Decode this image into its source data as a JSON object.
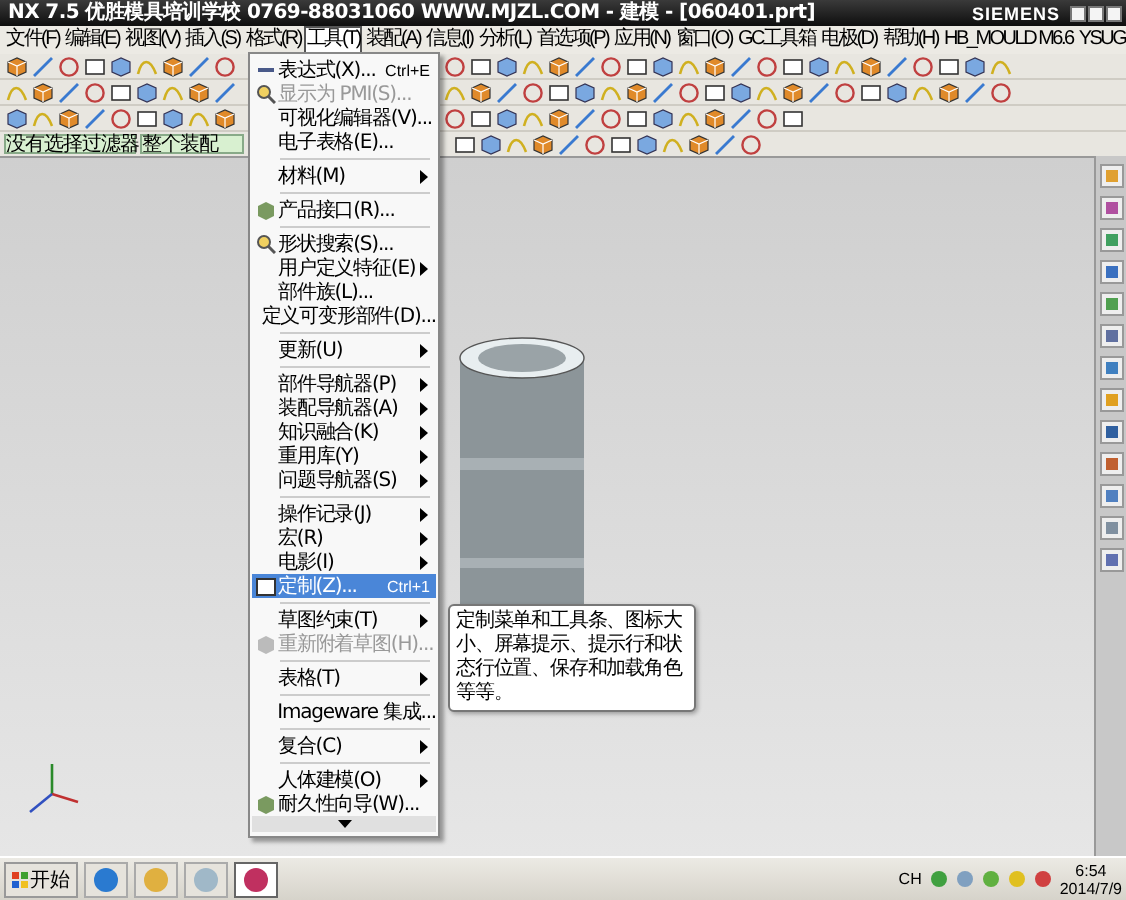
{
  "title_bar": {
    "title": "NX 7.5  优胜模具培训学校  0769-88031060  WWW.MJZL.COM - 建模 - [060401.prt]",
    "brand": "SIEMENS"
  },
  "menu_bar": {
    "items": [
      {
        "label": "文件(F)",
        "selected": false
      },
      {
        "label": "编辑(E)",
        "selected": false
      },
      {
        "label": "视图(V)",
        "selected": false
      },
      {
        "label": "插入(S)",
        "selected": false
      },
      {
        "label": "格式(R)",
        "selected": false
      },
      {
        "label": "工具(T)",
        "selected": true
      },
      {
        "label": "装配(A)",
        "selected": false
      },
      {
        "label": "信息(I)",
        "selected": false
      },
      {
        "label": "分析(L)",
        "selected": false
      },
      {
        "label": "首选项(P)",
        "selected": false
      },
      {
        "label": "应用(N)",
        "selected": false
      },
      {
        "label": "窗口(O)",
        "selected": false
      },
      {
        "label": "GC工具箱",
        "selected": false
      },
      {
        "label": "电极(D)",
        "selected": false
      },
      {
        "label": "帮助(H)",
        "selected": false
      },
      {
        "label": "HB_MOULD M6.6",
        "selected": false
      },
      {
        "label": "YSUG",
        "selected": false
      }
    ]
  },
  "selection_bar": {
    "filter": "没有选择过滤器",
    "scope": "整个装配"
  },
  "tools_menu": {
    "groups": [
      [
        {
          "label": "表达式(X)...",
          "shortcut": "Ctrl+E",
          "submenu": false,
          "disabled": false,
          "selected": false,
          "icon": true
        },
        {
          "label": "显示为 PMI(S)...",
          "submenu": false,
          "disabled": true,
          "selected": false,
          "icon": true
        },
        {
          "label": "可视化编辑器(V)...",
          "submenu": false,
          "disabled": false,
          "selected": false,
          "icon": false
        },
        {
          "label": "电子表格(E)...",
          "submenu": false,
          "disabled": false,
          "selected": false,
          "icon": false
        }
      ],
      [
        {
          "label": "材料(M)",
          "submenu": true,
          "disabled": false,
          "selected": false,
          "icon": false
        }
      ],
      [
        {
          "label": "产品接口(R)...",
          "submenu": false,
          "disabled": false,
          "selected": false,
          "icon": true
        }
      ],
      [
        {
          "label": "形状搜索(S)...",
          "submenu": false,
          "disabled": false,
          "selected": false,
          "icon": true
        },
        {
          "label": "用户定义特征(E)",
          "submenu": true,
          "disabled": false,
          "selected": false,
          "icon": false
        },
        {
          "label": "部件族(L)...",
          "submenu": false,
          "disabled": false,
          "selected": false,
          "icon": false
        },
        {
          "label": "定义可变形部件(D)...",
          "submenu": false,
          "disabled": false,
          "selected": false,
          "icon": false
        }
      ],
      [
        {
          "label": "更新(U)",
          "submenu": true,
          "disabled": false,
          "selected": false,
          "icon": false
        }
      ],
      [
        {
          "label": "部件导航器(P)",
          "submenu": true,
          "disabled": false,
          "selected": false,
          "icon": false
        },
        {
          "label": "装配导航器(A)",
          "submenu": true,
          "disabled": false,
          "selected": false,
          "icon": false
        },
        {
          "label": "知识融合(K)",
          "submenu": true,
          "disabled": false,
          "selected": false,
          "icon": false
        },
        {
          "label": "重用库(Y)",
          "submenu": true,
          "disabled": false,
          "selected": false,
          "icon": false
        },
        {
          "label": "问题导航器(S)",
          "submenu": true,
          "disabled": false,
          "selected": false,
          "icon": false
        }
      ],
      [
        {
          "label": "操作记录(J)",
          "submenu": true,
          "disabled": false,
          "selected": false,
          "icon": false
        },
        {
          "label": "宏(R)",
          "submenu": true,
          "disabled": false,
          "selected": false,
          "icon": false
        },
        {
          "label": "电影(I)",
          "submenu": true,
          "disabled": false,
          "selected": false,
          "icon": false
        },
        {
          "label": "定制(Z)...",
          "shortcut": "Ctrl+1",
          "submenu": false,
          "disabled": false,
          "selected": true,
          "icon": true
        }
      ],
      [
        {
          "label": "草图约束(T)",
          "submenu": true,
          "disabled": false,
          "selected": false,
          "icon": false
        },
        {
          "label": "重新附着草图(H)...",
          "submenu": false,
          "disabled": true,
          "selected": false,
          "icon": true
        }
      ],
      [
        {
          "label": "表格(T)",
          "submenu": true,
          "disabled": false,
          "selected": false,
          "icon": false
        }
      ],
      [
        {
          "label": "Imageware 集成...",
          "submenu": false,
          "disabled": false,
          "selected": false,
          "icon": false
        }
      ],
      [
        {
          "label": "复合(C)",
          "submenu": true,
          "disabled": false,
          "selected": false,
          "icon": false
        }
      ],
      [
        {
          "label": "人体建模(O)",
          "submenu": true,
          "disabled": false,
          "selected": false,
          "icon": false
        },
        {
          "label": "耐久性向导(W)...",
          "submenu": false,
          "disabled": false,
          "selected": false,
          "icon": true
        }
      ]
    ],
    "tooltip": "定制菜单和工具条、图标大小、屏幕提示、提示行和状态行位置、保存和加载角色等等。"
  },
  "taskbar": {
    "start": "开始",
    "apps": [
      {
        "selected": false
      },
      {
        "selected": false
      },
      {
        "selected": false
      },
      {
        "selected": true
      }
    ],
    "language": "CH",
    "time": "6:54",
    "date": "2014/7/9"
  }
}
